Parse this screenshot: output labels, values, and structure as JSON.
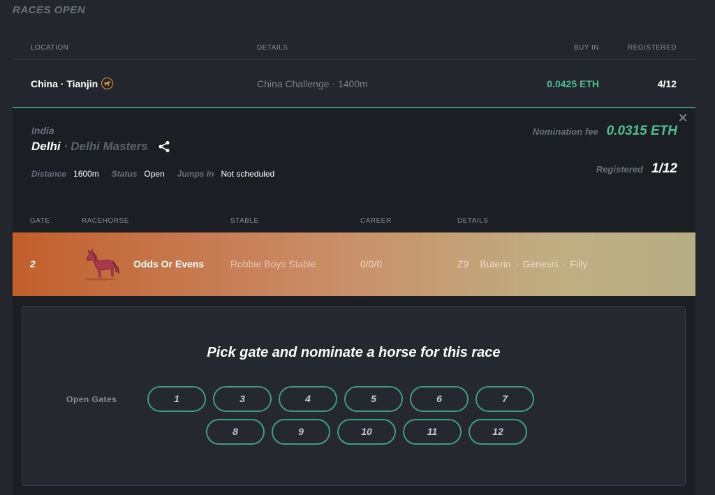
{
  "section_title": "RACES OPEN",
  "races_table": {
    "headers": {
      "location": "LOCATION",
      "details": "DETAILS",
      "buy_in": "BUY IN",
      "registered": "REGISTERED"
    },
    "rows": [
      {
        "location": "China · Tianjin",
        "details": "China Challenge · 1400m",
        "buy_in": "0.0425 ETH",
        "registered": "4/12"
      }
    ]
  },
  "expanded_race": {
    "country": "India",
    "city": "Delhi",
    "separator": "·",
    "race_name": "Delhi Masters",
    "meta": [
      {
        "label": "Distance",
        "value": "1600m"
      },
      {
        "label": "Status",
        "value": "Open"
      },
      {
        "label": "Jumps In",
        "value": "Not scheduled"
      }
    ],
    "nomination_fee_label": "Nomination fee",
    "nomination_fee_value": "0.0315 ETH",
    "registered_label": "Registered",
    "registered_value": "1/12",
    "entries_headers": {
      "gate": "GATE",
      "racehorse": "RACEHORSE",
      "stable": "STABLE",
      "career": "CAREER",
      "details": "DETAILS"
    },
    "entries": [
      {
        "gate": "2",
        "name": "Odds Or Evens",
        "stable": "Robbie Boys Stable",
        "career": "0/0/0",
        "zone": "Z9",
        "bloodline": "Buterin",
        "breed": "Genesis",
        "gender": "Filly"
      }
    ],
    "dot": "·",
    "nominate": {
      "heading": "Pick gate and nominate a horse for this race",
      "open_gates_label": "Open Gates",
      "gates_row1": [
        "1",
        "3",
        "4",
        "5",
        "6",
        "7"
      ],
      "gates_row2": [
        "8",
        "9",
        "10",
        "11",
        "12"
      ]
    }
  },
  "colors": {
    "accent_green": "#4fbf93",
    "gate_border": "#3f9e7c",
    "background": "#23262d",
    "panel": "#1b1e23",
    "highlight_orange": "#c25f2c"
  }
}
